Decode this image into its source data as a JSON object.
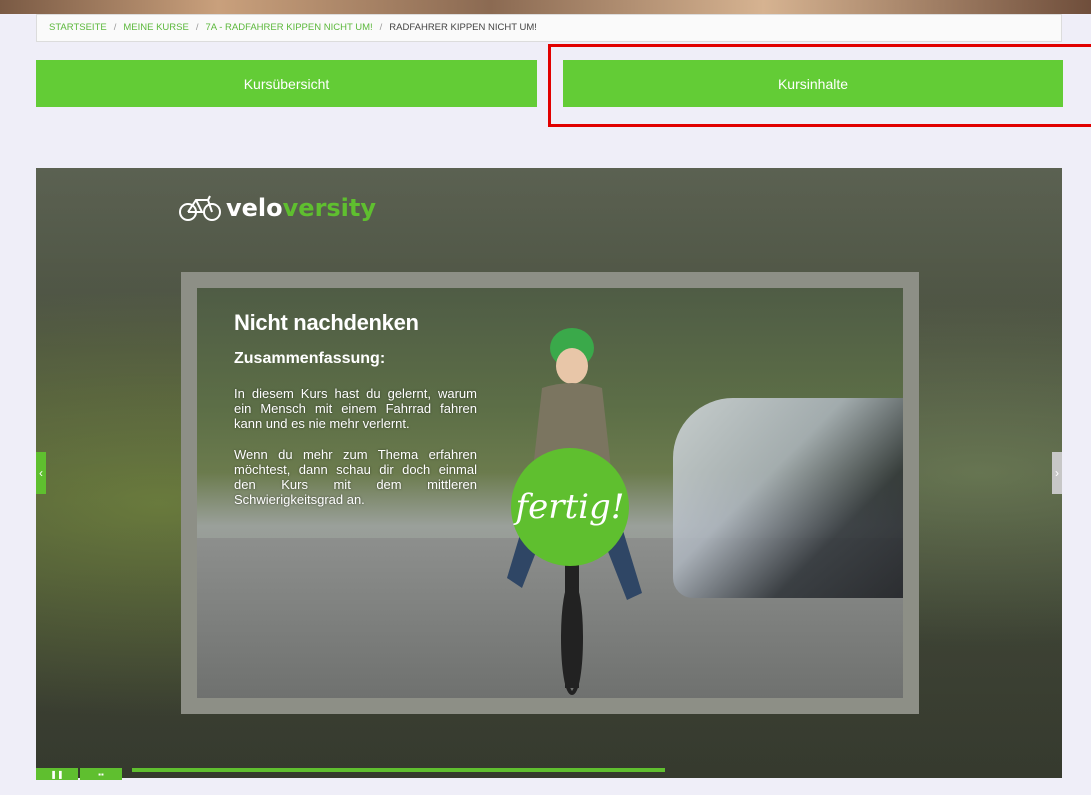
{
  "breadcrumb": {
    "items": [
      "STARTSEITE",
      "MEINE KURSE",
      "7A - RADFAHRER KIPPEN NICHT UM!"
    ],
    "current": "RADFAHRER KIPPEN NICHT UM!",
    "separator": "/"
  },
  "nav": {
    "overview_label": "Kursübersicht",
    "content_label": "Kursinhalte"
  },
  "logo": {
    "velo": "velo",
    "versity": "versity"
  },
  "slide": {
    "title": "Nicht nachdenken",
    "subtitle": "Zusammenfassung:",
    "paragraph1": "In diesem Kurs hast du gelernt, warum ein Mensch mit einem Fahrrad fahren kann und es nie mehr verlernt.",
    "paragraph2": "Wenn du mehr zum Thema erfahren möchtest, dann schau dir doch einmal den Kurs mit dem mittleren Schwierigkeitsgrad an.",
    "badge": "fertig!"
  },
  "player": {
    "prev_symbol": "‹",
    "next_symbol": "›",
    "pause_symbol": "❚❚",
    "menu_symbol": "▪▪",
    "progress": 0.573
  },
  "colors": {
    "accent": "#63cc36",
    "highlight": "#e10000"
  }
}
